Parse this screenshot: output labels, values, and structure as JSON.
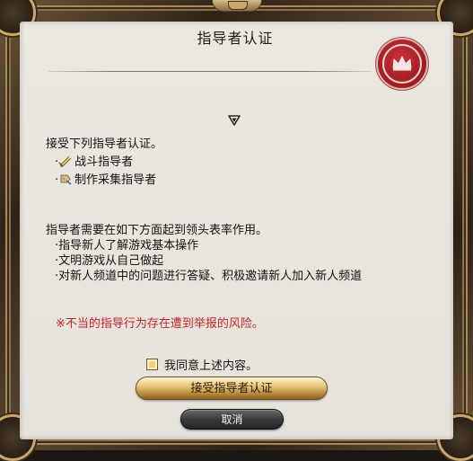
{
  "dialog": {
    "title": "指导者认证",
    "intro": "接受下列指导者认证。",
    "certifications": [
      {
        "label": "战斗指导者",
        "icon": "battle-mentor-icon"
      },
      {
        "label": "制作采集指导者",
        "icon": "crafting-gathering-mentor-icon"
      }
    ],
    "duties_intro": "指导者需要在如下方面起到领头表率作用。",
    "duties": [
      "·指导新人了解游戏基本操作",
      "·文明游戏从自己做起",
      "·对新人频道中的问题进行答疑、积极邀请新人加入新人频道"
    ],
    "warning": "※不当的指导行为存在遭到举报的风险。",
    "agree_label": "我同意上述内容。",
    "agree_checked": false,
    "confirm_button": "接受指导者认证",
    "cancel_button": "取消",
    "bullet_prefix": "·"
  },
  "colors": {
    "warning": "#c8232b",
    "badge": "#a31e26",
    "primary_button": "#e8c878",
    "secondary_button": "#3a3a3a"
  }
}
